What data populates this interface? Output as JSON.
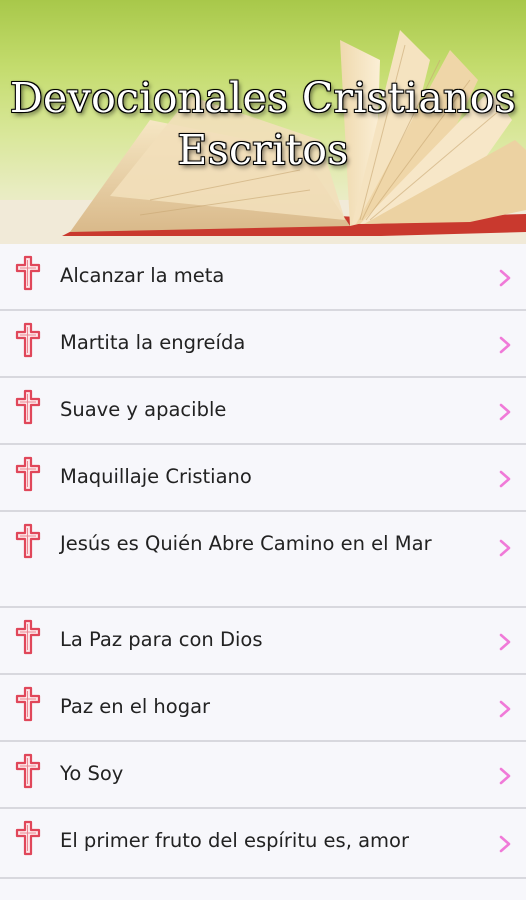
{
  "header": {
    "title_line1": "Devocionales Cristianos",
    "title_line2": "Escritos"
  },
  "items": [
    {
      "label": "Alcanzar la meta"
    },
    {
      "label": "Martita la engreída"
    },
    {
      "label": "Suave y apacible"
    },
    {
      "label": "Maquillaje Cristiano"
    },
    {
      "label": "Jesús es Quién Abre Camino en el Mar"
    },
    {
      "label": "La Paz para con Dios"
    },
    {
      "label": "Paz en el hogar"
    },
    {
      "label": "Yo Soy"
    },
    {
      "label": "El primer fruto del espíritu es, amor"
    }
  ],
  "icons": {
    "row_icon": "cross-icon",
    "row_arrow": "chevron-right-icon"
  },
  "colors": {
    "cross": "#e0475a",
    "chevron": "#f07ad8",
    "divider": "#d8d8de"
  }
}
